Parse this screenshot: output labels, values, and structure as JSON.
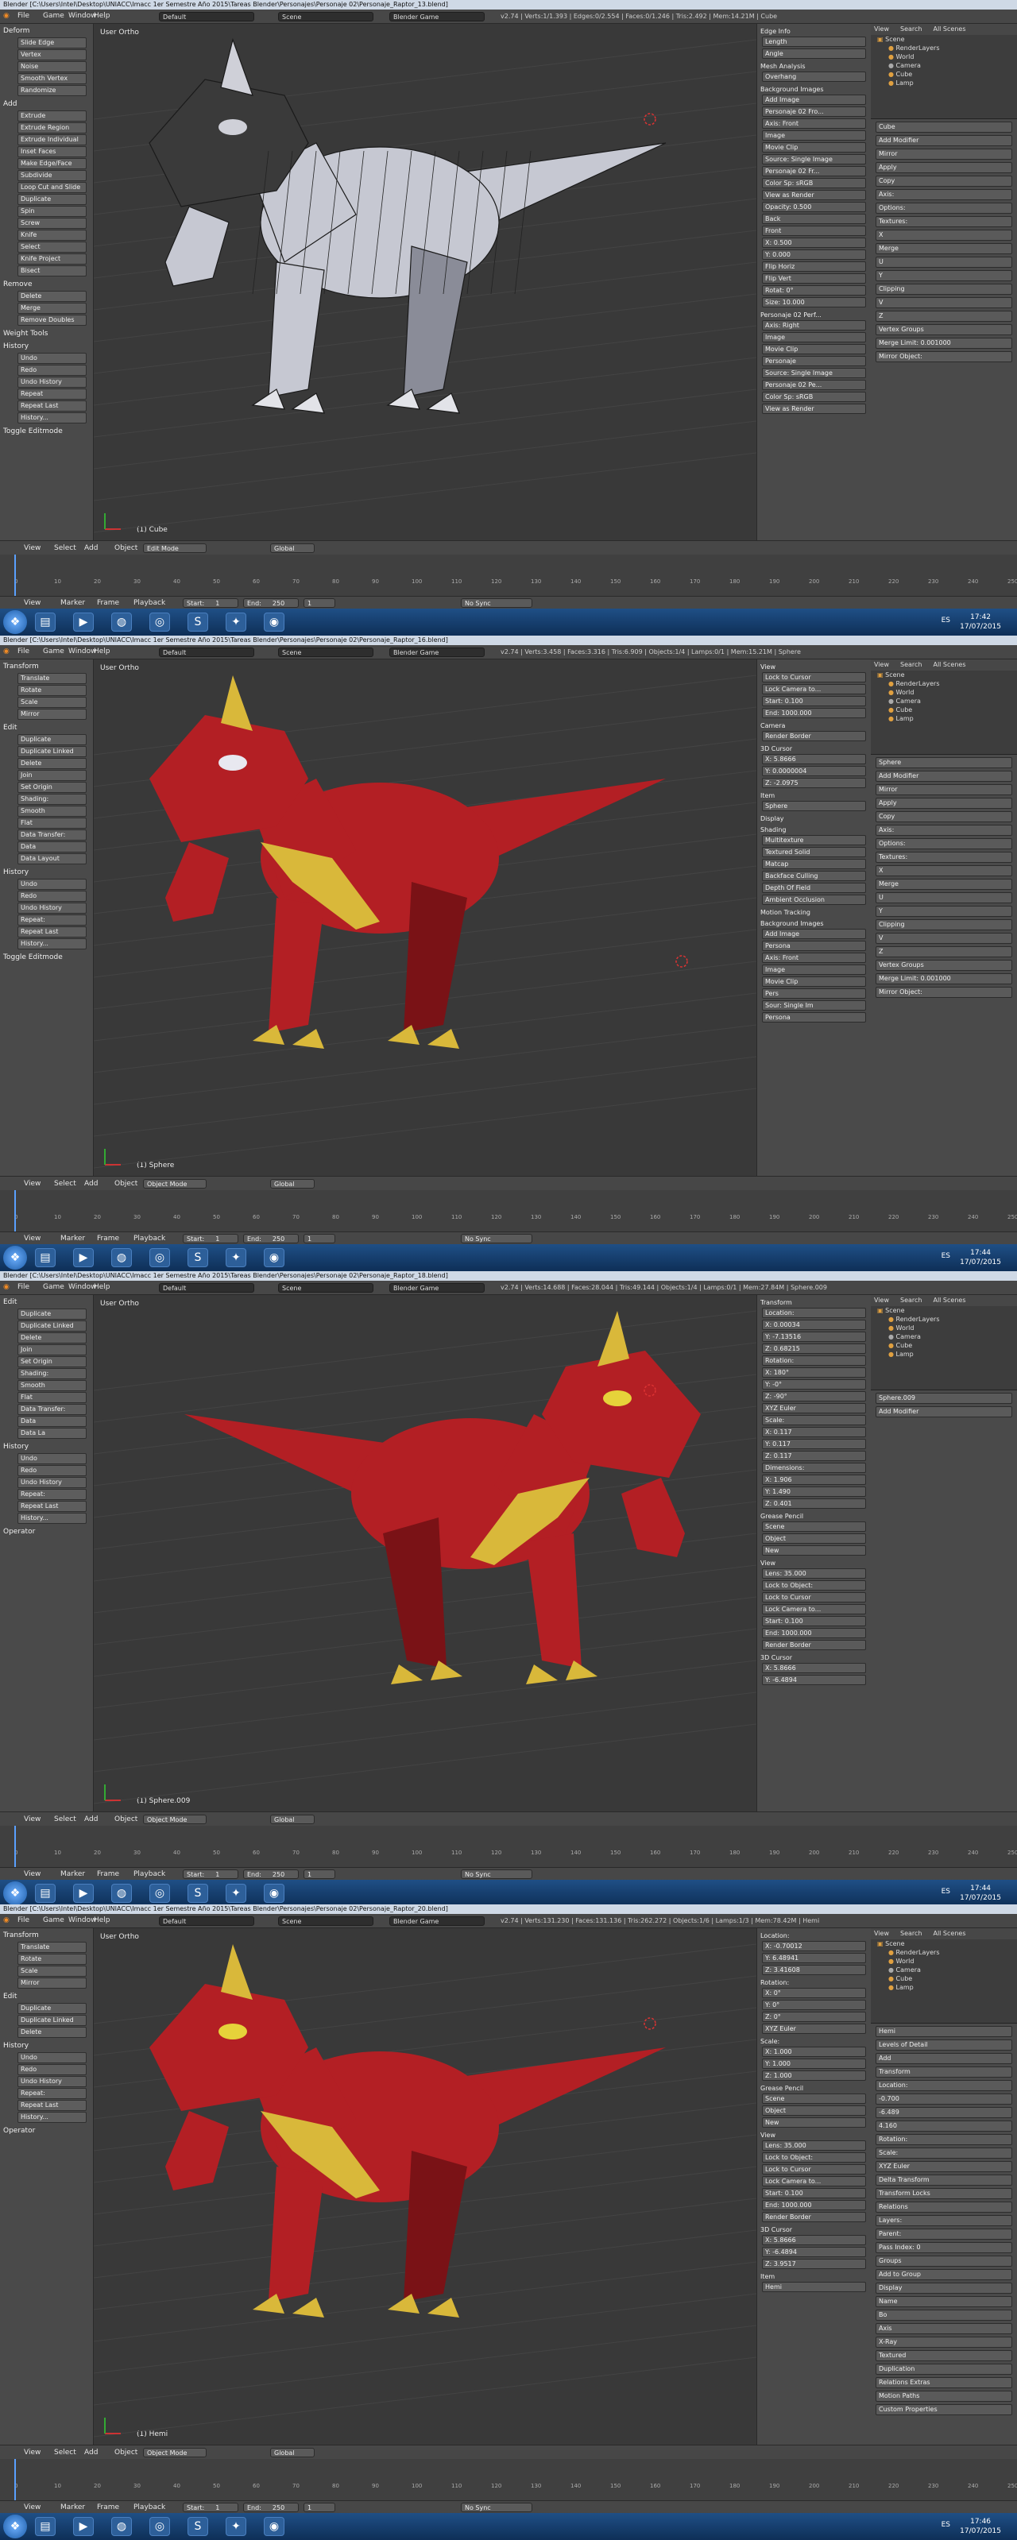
{
  "colors": {
    "viewport": "#393939",
    "panel": "#4a4a4a",
    "accent": "#5680c2",
    "dino_red": "#b31f24",
    "dino_yellow": "#d9b83a",
    "wire": "#1a1a1a",
    "taskbar": "#1f4f86"
  },
  "common": {
    "menu": [
      "File",
      "Game",
      "Window",
      "Help"
    ],
    "layout": "Default",
    "scene": "Scene",
    "engine": "Blender Game",
    "view_menus": [
      "View",
      "Select",
      "Add",
      "Object"
    ],
    "timeline_menus": [
      "View",
      "Marker",
      "Frame",
      "Playback"
    ],
    "start_label": "Start:",
    "start_value": "1",
    "end_label": "End:",
    "end_value": "250",
    "frame_value": "1",
    "sync": "No Sync",
    "pivot": "Global",
    "viewport_label": "User Ortho",
    "lang": "ES",
    "ticks": [
      "0",
      "10",
      "20",
      "30",
      "40",
      "50",
      "60",
      "70",
      "80",
      "90",
      "100",
      "110",
      "120",
      "130",
      "140",
      "150",
      "160",
      "170",
      "180",
      "190",
      "200",
      "210",
      "220",
      "230",
      "240",
      "250"
    ],
    "taskbar_icons": [
      "folder-icon",
      "media-icon",
      "firefox-icon",
      "chrome-icon",
      "skype-icon",
      "app-icon",
      "blender-icon"
    ],
    "outliner_items": [
      "Scene",
      "RenderLayers",
      "World",
      "Camera",
      "Cube",
      "Lamp"
    ],
    "props_tabs": [
      "View",
      "Search",
      "All Scenes"
    ]
  },
  "frames": [
    {
      "title": "Blender [C:\\Users\\Intel\\Desktop\\UNIACC\\Imacc 1er Semestre Año 2015\\Tareas Blender\\Personajes\\Personaje 02\\Personaje_Raptor_13.blend]",
      "stats": "v2.74 | Verts:1/1.393 | Edges:0/2.554 | Faces:0/1.246 | Tris:2.492 | Mem:14.21M | Cube",
      "mode": "Edit Mode",
      "object": "(1) Cube",
      "time": "17:42",
      "date": "17/07/2015",
      "tool_sections": [
        {
          "title": "Deform",
          "buttons": [
            "Slide Edge",
            "Vertex",
            "Noise",
            "Smooth Vertex",
            "Randomize"
          ]
        },
        {
          "title": "Add",
          "buttons": [
            "Extrude",
            "Extrude Region",
            "Extrude Individual",
            "Inset Faces",
            "Make Edge/Face",
            "Subdivide",
            "Loop Cut and Slide",
            "Duplicate",
            "Spin",
            "Screw",
            "Knife",
            "Select",
            "Knife Project",
            "Bisect"
          ]
        },
        {
          "title": "Remove",
          "buttons": [
            "Delete",
            "Merge",
            "Remove Doubles"
          ]
        },
        {
          "title": "Weight Tools",
          "buttons": []
        },
        {
          "title": "History",
          "buttons": [
            "Undo",
            "Redo",
            "Undo History",
            "Repeat",
            "Repeat Last",
            "History..."
          ]
        },
        {
          "title": "Toggle Editmode",
          "buttons": []
        }
      ],
      "npanel": [
        {
          "hdr": "Edge Info",
          "rows": [
            "Length",
            "Angle"
          ]
        },
        {
          "hdr": "Mesh Analysis",
          "rows": [
            "Overhang"
          ]
        },
        {
          "hdr": "Background Images",
          "rows": [
            "Add Image",
            "Personaje 02 Fro...",
            "Axis: Front",
            "Image",
            "Movie Clip",
            "Source: Single Image",
            "Personaje 02 Fr...",
            "Color Sp: sRGB",
            "View as Render",
            "Opacity: 0.500",
            "Back",
            "Front",
            "X: 0.500",
            "Y: 0.000",
            "Flip Horiz",
            "Flip Vert",
            "Rotat: 0°",
            "Size: 10.000"
          ]
        },
        {
          "hdr": "Personaje 02 Perf...",
          "rows": [
            "Axis: Right",
            "Image",
            "Movie Clip",
            "Personaje",
            "Source: Single Image",
            "Personaje 02 Pe...",
            "Color Sp: sRGB",
            "View as Render"
          ]
        }
      ],
      "props_rows": [
        "Cube",
        "Add Modifier",
        "Mirror",
        "Apply",
        "Copy",
        "Axis:",
        "Options:",
        "Textures:",
        "X",
        "Merge",
        "U",
        "Y",
        "Clipping",
        "V",
        "Z",
        "Vertex Groups",
        "Merge Limit: 0.001000",
        "Mirror Object:"
      ]
    },
    {
      "title": "Blender [C:\\Users\\Intel\\Desktop\\UNIACC\\Imacc 1er Semestre Año 2015\\Tareas Blender\\Personajes\\Personaje 02\\Personaje_Raptor_16.blend]",
      "stats": "v2.74 | Verts:3.458 | Faces:3.316 | Tris:6.909 | Objects:1/4 | Lamps:0/1 | Mem:15.21M | Sphere",
      "mode": "Object Mode",
      "object": "(1) Sphere",
      "time": "17:44",
      "date": "17/07/2015",
      "tool_sections": [
        {
          "title": "Transform",
          "buttons": [
            "Translate",
            "Rotate",
            "Scale",
            "Mirror"
          ]
        },
        {
          "title": "Edit",
          "buttons": [
            "Duplicate",
            "Duplicate Linked",
            "Delete",
            "Join",
            "Set Origin",
            "Shading:",
            "Smooth",
            "Flat",
            "Data Transfer:",
            "Data",
            "Data Layout"
          ]
        },
        {
          "title": "History",
          "buttons": [
            "Undo",
            "Redo",
            "Undo History",
            "Repeat:",
            "Repeat Last",
            "History..."
          ]
        },
        {
          "title": "Toggle Editmode",
          "buttons": []
        }
      ],
      "npanel": [
        {
          "hdr": "View",
          "rows": [
            "Lock to Cursor",
            "Lock Camera to...",
            "Start: 0.100",
            "End: 1000.000"
          ]
        },
        {
          "hdr": "Camera",
          "rows": [
            "Render Border"
          ]
        },
        {
          "hdr": "3D Cursor",
          "rows": [
            "X: 5.8666",
            "Y: 0.0000004",
            "Z: -2.0975"
          ]
        },
        {
          "hdr": "Item",
          "rows": [
            "Sphere"
          ]
        },
        {
          "hdr": "Display",
          "rows": []
        },
        {
          "hdr": "Shading",
          "rows": [
            "Multitexture",
            "Textured Solid",
            "Matcap",
            "Backface Culling",
            "Depth Of Field",
            "Ambient Occlusion"
          ]
        },
        {
          "hdr": "Motion Tracking",
          "rows": []
        },
        {
          "hdr": "Background Images",
          "rows": [
            "Add Image",
            "Persona",
            "Axis: Front",
            "Image",
            "Movie Clip",
            "Pers",
            "Sour: Single Im",
            "Persona"
          ]
        }
      ],
      "props_rows": [
        "Sphere",
        "Add Modifier",
        "Mirror",
        "Apply",
        "Copy",
        "Axis:",
        "Options:",
        "Textures:",
        "X",
        "Merge",
        "U",
        "Y",
        "Clipping",
        "V",
        "Z",
        "Vertex Groups",
        "Merge Limit: 0.001000",
        "Mirror Object:"
      ]
    },
    {
      "title": "Blender [C:\\Users\\Intel\\Desktop\\UNIACC\\Imacc 1er Semestre Año 2015\\Tareas Blender\\Personajes\\Personaje 02\\Personaje_Raptor_18.blend]",
      "stats": "v2.74 | Verts:14.688 | Faces:28.044 | Tris:49.144 | Objects:1/4 | Lamps:0/1 | Mem:27.84M | Sphere.009",
      "mode": "Object Mode",
      "object": "(1) Sphere.009",
      "time": "17:44",
      "date": "17/07/2015",
      "tool_sections": [
        {
          "title": "Edit",
          "buttons": [
            "Duplicate",
            "Duplicate Linked",
            "Delete",
            "Join",
            "Set Origin",
            "Shading:",
            "Smooth",
            "Flat",
            "Data Transfer:",
            "Data",
            "Data La"
          ]
        },
        {
          "title": "History",
          "buttons": [
            "Undo",
            "Redo",
            "Undo History",
            "Repeat:",
            "Repeat Last",
            "History..."
          ]
        },
        {
          "title": "Operator",
          "buttons": []
        }
      ],
      "npanel": [
        {
          "hdr": "Transform",
          "rows": [
            "Location:",
            "X: 0.00034",
            "Y: -7.13516",
            "Z: 0.68215",
            "Rotation:",
            "X: 180°",
            "Y: -0°",
            "Z: -90°",
            "XYZ Euler",
            "Scale:",
            "X: 0.117",
            "Y: 0.117",
            "Z: 0.117",
            "Dimensions:",
            "X: 1.906",
            "Y: 1.490",
            "Z: 0.401"
          ]
        },
        {
          "hdr": "Grease Pencil",
          "rows": [
            "Scene",
            "Object",
            "New"
          ]
        },
        {
          "hdr": "View",
          "rows": [
            "Lens: 35.000",
            "Lock to Object:",
            "Lock to Cursor",
            "Lock Camera to...",
            "Start: 0.100",
            "End: 1000.000",
            "Render Border"
          ]
        },
        {
          "hdr": "3D Cursor",
          "rows": [
            "X: 5.8666",
            "Y: -6.4894"
          ]
        }
      ],
      "props_rows": [
        "Sphere.009",
        "Add Modifier"
      ]
    },
    {
      "title": "Blender [C:\\Users\\Intel\\Desktop\\UNIACC\\Imacc 1er Semestre Año 2015\\Tareas Blender\\Personajes\\Personaje 02\\Personaje_Raptor_20.blend]",
      "stats": "v2.74 | Verts:131.230 | Faces:131.136 | Tris:262.272 | Objects:1/6 | Lamps:1/3 | Mem:78.42M | Hemi",
      "mode": "Object Mode",
      "object": "(1) Hemi",
      "time": "17:46",
      "date": "17/07/2015",
      "tool_sections": [
        {
          "title": "Transform",
          "buttons": [
            "Translate",
            "Rotate",
            "Scale",
            "Mirror"
          ]
        },
        {
          "title": "Edit",
          "buttons": [
            "Duplicate",
            "Duplicate Linked",
            "Delete"
          ]
        },
        {
          "title": "History",
          "buttons": [
            "Undo",
            "Redo",
            "Undo History",
            "Repeat:",
            "Repeat Last",
            "History..."
          ]
        },
        {
          "title": "Operator",
          "buttons": []
        }
      ],
      "npanel": [
        {
          "hdr": "Location:",
          "rows": [
            "X: -0.70012",
            "Y: 6.48941",
            "Z: 3.41608"
          ]
        },
        {
          "hdr": "Rotation:",
          "rows": [
            "X: 0°",
            "Y: 0°",
            "Z: 0°",
            "XYZ Euler"
          ]
        },
        {
          "hdr": "Scale:",
          "rows": [
            "X: 1.000",
            "Y: 1.000",
            "Z: 1.000"
          ]
        },
        {
          "hdr": "Grease Pencil",
          "rows": [
            "Scene",
            "Object",
            "New"
          ]
        },
        {
          "hdr": "View",
          "rows": [
            "Lens: 35.000",
            "Lock to Object:",
            "Lock to Cursor",
            "Lock Camera to...",
            "Start: 0.100",
            "End: 1000.000",
            "Render Border"
          ]
        },
        {
          "hdr": "3D Cursor",
          "rows": [
            "X: 5.8666",
            "Y: -6.4894",
            "Z: 3.9517"
          ]
        },
        {
          "hdr": "Item",
          "rows": [
            "Hemi"
          ]
        }
      ],
      "props_rows": [
        "Hemi",
        "Levels of Detail",
        "Add",
        "Transform",
        "Location:",
        "-0.700",
        "-6.489",
        "4.160",
        "Rotation:",
        "Scale:",
        "XYZ Euler",
        "Delta Transform",
        "Transform Locks",
        "Relations",
        "Layers:",
        "Parent:",
        "Pass Index: 0",
        "Groups",
        "Add to Group",
        "Display",
        "Name",
        "Bo",
        "Axis",
        "X-Ray",
        "Textured",
        "Duplication",
        "Relations Extras",
        "Motion Paths",
        "Custom Properties"
      ]
    }
  ]
}
